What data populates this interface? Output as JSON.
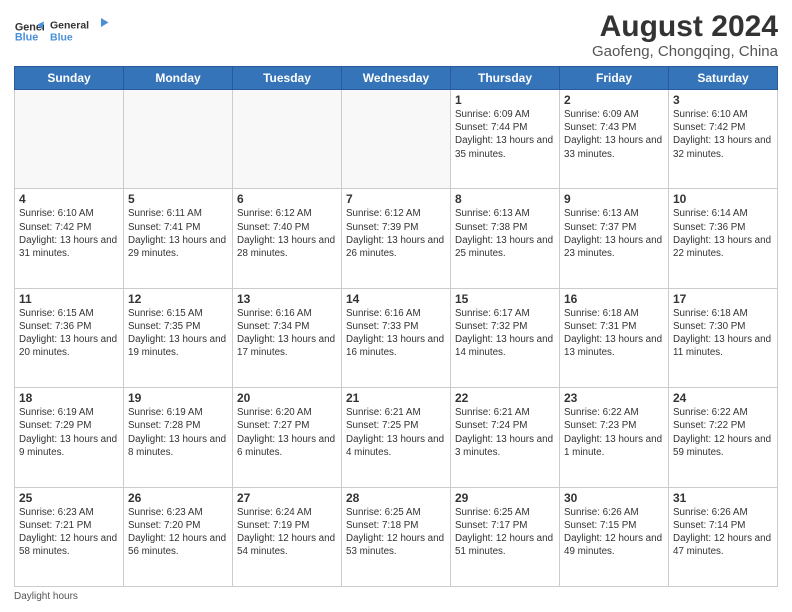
{
  "header": {
    "logo_line1": "General",
    "logo_line2": "Blue",
    "title": "August 2024",
    "subtitle": "Gaofeng, Chongqing, China"
  },
  "days_of_week": [
    "Sunday",
    "Monday",
    "Tuesday",
    "Wednesday",
    "Thursday",
    "Friday",
    "Saturday"
  ],
  "weeks": [
    [
      {
        "day": "",
        "info": ""
      },
      {
        "day": "",
        "info": ""
      },
      {
        "day": "",
        "info": ""
      },
      {
        "day": "",
        "info": ""
      },
      {
        "day": "1",
        "info": "Sunrise: 6:09 AM\nSunset: 7:44 PM\nDaylight: 13 hours\nand 35 minutes."
      },
      {
        "day": "2",
        "info": "Sunrise: 6:09 AM\nSunset: 7:43 PM\nDaylight: 13 hours\nand 33 minutes."
      },
      {
        "day": "3",
        "info": "Sunrise: 6:10 AM\nSunset: 7:42 PM\nDaylight: 13 hours\nand 32 minutes."
      }
    ],
    [
      {
        "day": "4",
        "info": "Sunrise: 6:10 AM\nSunset: 7:42 PM\nDaylight: 13 hours\nand 31 minutes."
      },
      {
        "day": "5",
        "info": "Sunrise: 6:11 AM\nSunset: 7:41 PM\nDaylight: 13 hours\nand 29 minutes."
      },
      {
        "day": "6",
        "info": "Sunrise: 6:12 AM\nSunset: 7:40 PM\nDaylight: 13 hours\nand 28 minutes."
      },
      {
        "day": "7",
        "info": "Sunrise: 6:12 AM\nSunset: 7:39 PM\nDaylight: 13 hours\nand 26 minutes."
      },
      {
        "day": "8",
        "info": "Sunrise: 6:13 AM\nSunset: 7:38 PM\nDaylight: 13 hours\nand 25 minutes."
      },
      {
        "day": "9",
        "info": "Sunrise: 6:13 AM\nSunset: 7:37 PM\nDaylight: 13 hours\nand 23 minutes."
      },
      {
        "day": "10",
        "info": "Sunrise: 6:14 AM\nSunset: 7:36 PM\nDaylight: 13 hours\nand 22 minutes."
      }
    ],
    [
      {
        "day": "11",
        "info": "Sunrise: 6:15 AM\nSunset: 7:36 PM\nDaylight: 13 hours\nand 20 minutes."
      },
      {
        "day": "12",
        "info": "Sunrise: 6:15 AM\nSunset: 7:35 PM\nDaylight: 13 hours\nand 19 minutes."
      },
      {
        "day": "13",
        "info": "Sunrise: 6:16 AM\nSunset: 7:34 PM\nDaylight: 13 hours\nand 17 minutes."
      },
      {
        "day": "14",
        "info": "Sunrise: 6:16 AM\nSunset: 7:33 PM\nDaylight: 13 hours\nand 16 minutes."
      },
      {
        "day": "15",
        "info": "Sunrise: 6:17 AM\nSunset: 7:32 PM\nDaylight: 13 hours\nand 14 minutes."
      },
      {
        "day": "16",
        "info": "Sunrise: 6:18 AM\nSunset: 7:31 PM\nDaylight: 13 hours\nand 13 minutes."
      },
      {
        "day": "17",
        "info": "Sunrise: 6:18 AM\nSunset: 7:30 PM\nDaylight: 13 hours\nand 11 minutes."
      }
    ],
    [
      {
        "day": "18",
        "info": "Sunrise: 6:19 AM\nSunset: 7:29 PM\nDaylight: 13 hours\nand 9 minutes."
      },
      {
        "day": "19",
        "info": "Sunrise: 6:19 AM\nSunset: 7:28 PM\nDaylight: 13 hours\nand 8 minutes."
      },
      {
        "day": "20",
        "info": "Sunrise: 6:20 AM\nSunset: 7:27 PM\nDaylight: 13 hours\nand 6 minutes."
      },
      {
        "day": "21",
        "info": "Sunrise: 6:21 AM\nSunset: 7:25 PM\nDaylight: 13 hours\nand 4 minutes."
      },
      {
        "day": "22",
        "info": "Sunrise: 6:21 AM\nSunset: 7:24 PM\nDaylight: 13 hours\nand 3 minutes."
      },
      {
        "day": "23",
        "info": "Sunrise: 6:22 AM\nSunset: 7:23 PM\nDaylight: 13 hours\nand 1 minute."
      },
      {
        "day": "24",
        "info": "Sunrise: 6:22 AM\nSunset: 7:22 PM\nDaylight: 12 hours\nand 59 minutes."
      }
    ],
    [
      {
        "day": "25",
        "info": "Sunrise: 6:23 AM\nSunset: 7:21 PM\nDaylight: 12 hours\nand 58 minutes."
      },
      {
        "day": "26",
        "info": "Sunrise: 6:23 AM\nSunset: 7:20 PM\nDaylight: 12 hours\nand 56 minutes."
      },
      {
        "day": "27",
        "info": "Sunrise: 6:24 AM\nSunset: 7:19 PM\nDaylight: 12 hours\nand 54 minutes."
      },
      {
        "day": "28",
        "info": "Sunrise: 6:25 AM\nSunset: 7:18 PM\nDaylight: 12 hours\nand 53 minutes."
      },
      {
        "day": "29",
        "info": "Sunrise: 6:25 AM\nSunset: 7:17 PM\nDaylight: 12 hours\nand 51 minutes."
      },
      {
        "day": "30",
        "info": "Sunrise: 6:26 AM\nSunset: 7:15 PM\nDaylight: 12 hours\nand 49 minutes."
      },
      {
        "day": "31",
        "info": "Sunrise: 6:26 AM\nSunset: 7:14 PM\nDaylight: 12 hours\nand 47 minutes."
      }
    ]
  ],
  "footer": {
    "daylight_label": "Daylight hours"
  }
}
